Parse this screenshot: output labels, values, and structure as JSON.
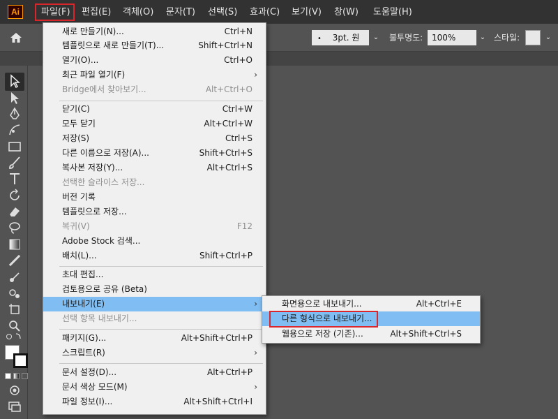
{
  "app": {
    "logo": "Ai"
  },
  "menubar": {
    "file": "파일(F)",
    "edit": "편집(E)",
    "object": "객체(O)",
    "type": "문자(T)",
    "select": "선택(S)",
    "effect": "효과(C)",
    "view": "보기(V)",
    "window": "창(W)",
    "help": "도움말(H)"
  },
  "controlbar": {
    "brush": "3pt. 원",
    "opacity_label": "불투명도:",
    "opacity_value": "100%",
    "style_label": "스타일:"
  },
  "file_menu": {
    "new": {
      "label": "새로 만들기(N)...",
      "shortcut": "Ctrl+N"
    },
    "new_from_template": {
      "label": "템플릿으로 새로 만들기(T)...",
      "shortcut": "Shift+Ctrl+N"
    },
    "open": {
      "label": "열기(O)...",
      "shortcut": "Ctrl+O"
    },
    "open_recent": {
      "label": "최근 파일 열기(F)"
    },
    "bridge": {
      "label": "Bridge에서 찾아보기...",
      "shortcut": "Alt+Ctrl+O"
    },
    "close": {
      "label": "닫기(C)",
      "shortcut": "Ctrl+W"
    },
    "close_all": {
      "label": "모두 닫기",
      "shortcut": "Alt+Ctrl+W"
    },
    "save": {
      "label": "저장(S)",
      "shortcut": "Ctrl+S"
    },
    "save_as": {
      "label": "다른 이름으로 저장(A)...",
      "shortcut": "Shift+Ctrl+S"
    },
    "save_copy": {
      "label": "복사본 저장(Y)...",
      "shortcut": "Alt+Ctrl+S"
    },
    "save_slices": {
      "label": "선택한 슬라이스 저장..."
    },
    "version_history": {
      "label": "버전 기록"
    },
    "save_template": {
      "label": "템플릿으로 저장..."
    },
    "revert": {
      "label": "복귀(V)",
      "shortcut": "F12"
    },
    "adobe_stock": {
      "label": "Adobe Stock 검색..."
    },
    "place": {
      "label": "배치(L)...",
      "shortcut": "Shift+Ctrl+P"
    },
    "invite": {
      "label": "초대 편집..."
    },
    "share_review": {
      "label": "검토용으로 공유 (Beta)"
    },
    "export": {
      "label": "내보내기(E)"
    },
    "export_selection": {
      "label": "선택 항목 내보내기..."
    },
    "package": {
      "label": "패키지(G)...",
      "shortcut": "Alt+Shift+Ctrl+P"
    },
    "scripts": {
      "label": "스크립트(R)"
    },
    "doc_setup": {
      "label": "문서 설정(D)...",
      "shortcut": "Alt+Ctrl+P"
    },
    "doc_color": {
      "label": "문서 색상 모드(M)"
    },
    "file_info": {
      "label": "파일 정보(I)...",
      "shortcut": "Alt+Shift+Ctrl+I"
    }
  },
  "export_submenu": {
    "screens": {
      "label": "화면용으로 내보내기...",
      "shortcut": "Alt+Ctrl+E"
    },
    "export_as": {
      "label": "다른 형식으로 내보내기..."
    },
    "save_web": {
      "label": "웹용으로 저장 (기존)...",
      "shortcut": "Alt+Shift+Ctrl+S"
    }
  },
  "colors": {
    "highlight": "#80bdf2",
    "callout": "#d8262c",
    "logo_accent": "#ff9a00"
  }
}
